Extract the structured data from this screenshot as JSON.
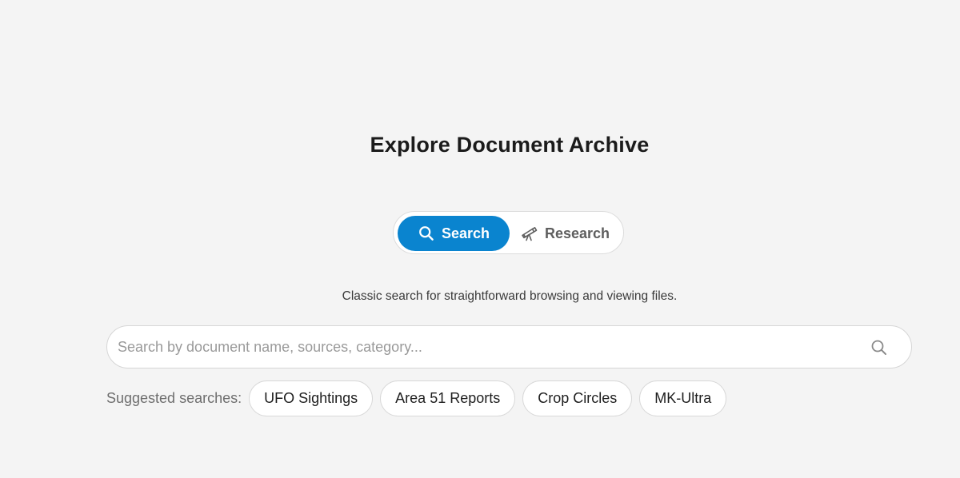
{
  "page": {
    "title": "Explore Document Archive",
    "description": "Classic search for straightforward browsing and viewing files."
  },
  "mode_toggle": {
    "active": "Search",
    "options": [
      {
        "label": "Search",
        "icon": "search-icon",
        "selected": true
      },
      {
        "label": "Research",
        "icon": "telescope-icon",
        "selected": false
      }
    ]
  },
  "search": {
    "placeholder": "Search by document name, sources, category...",
    "value": "",
    "submit_icon": "search-icon"
  },
  "suggestions": {
    "label": "Suggested searches:",
    "items": [
      "UFO Sightings",
      "Area 51 Reports",
      "Crop Circles",
      "MK-Ultra"
    ]
  },
  "colors": {
    "background": "#f4f4f4",
    "accent": "#0a84cf",
    "surface": "#ffffff",
    "border": "#d8d8d8"
  }
}
